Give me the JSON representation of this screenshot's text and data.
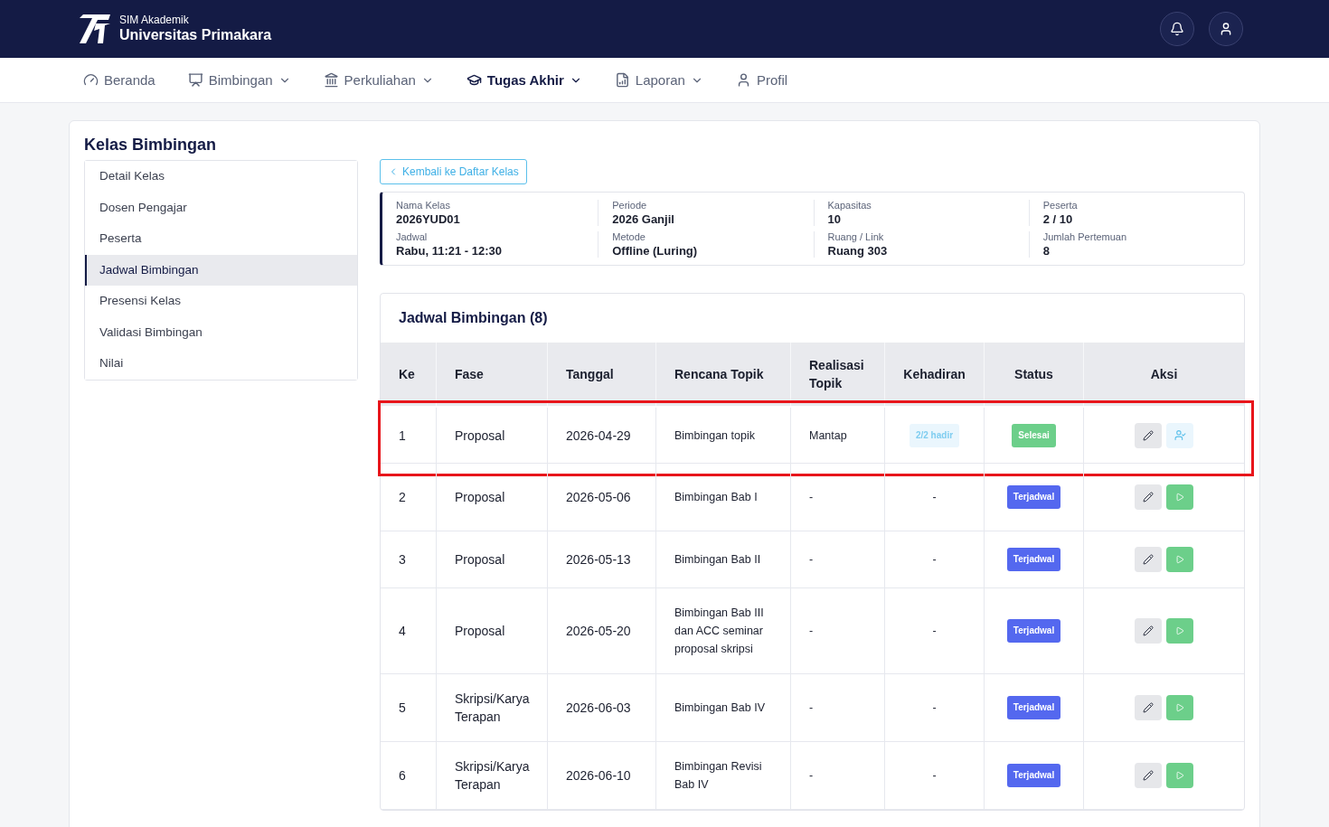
{
  "header": {
    "subtitle": "SIM Akademik",
    "title": "Universitas Primakara"
  },
  "nav": [
    {
      "label": "Beranda",
      "dropdown": false,
      "selected": false
    },
    {
      "label": "Bimbingan",
      "dropdown": true,
      "selected": false
    },
    {
      "label": "Perkuliahan",
      "dropdown": true,
      "selected": false
    },
    {
      "label": "Tugas Akhir",
      "dropdown": true,
      "selected": true
    },
    {
      "label": "Laporan",
      "dropdown": true,
      "selected": false
    },
    {
      "label": "Profil",
      "dropdown": false,
      "selected": false
    }
  ],
  "page_title": "Kelas Bimbingan",
  "sidebar": {
    "items": [
      {
        "label": "Detail Kelas",
        "selected": false
      },
      {
        "label": "Dosen Pengajar",
        "selected": false
      },
      {
        "label": "Peserta",
        "selected": false
      },
      {
        "label": "Jadwal Bimbingan",
        "selected": true
      },
      {
        "label": "Presensi Kelas",
        "selected": false
      },
      {
        "label": "Validasi Bimbingan",
        "selected": false
      },
      {
        "label": "Nilai",
        "selected": false
      }
    ]
  },
  "back_button": "Kembali ke Daftar Kelas",
  "info": [
    {
      "label": "Nama Kelas",
      "value": "2026YUD01"
    },
    {
      "label": "Periode",
      "value": "2026 Ganjil"
    },
    {
      "label": "Kapasitas",
      "value": "10"
    },
    {
      "label": "Peserta",
      "value": "2 / 10"
    },
    {
      "label": "Jadwal",
      "value": "Rabu, 11:21 - 12:30"
    },
    {
      "label": "Metode",
      "value": "Offline (Luring)"
    },
    {
      "label": "Ruang / Link",
      "value": "Ruang 303"
    },
    {
      "label": "Jumlah Pertemuan",
      "value": "8"
    }
  ],
  "table": {
    "title": "Jadwal Bimbingan (8)",
    "columns": [
      "Ke",
      "Fase",
      "Tanggal",
      "Rencana Topik",
      "Realisasi Topik",
      "Kehadiran",
      "Status",
      "Aksi"
    ],
    "rows": [
      {
        "ke": "1",
        "fase": "Proposal",
        "tanggal": "2026-04-29",
        "rencana": "Bimbingan topik",
        "realisasi": "Mantap",
        "kehadiran": {
          "kind": "badge",
          "text": "2/2 hadir"
        },
        "status": {
          "text": "Selesai",
          "color": "#6ccf8a"
        },
        "actions": [
          {
            "kind": "edit"
          },
          {
            "kind": "attendance"
          }
        ],
        "highlighted": true
      },
      {
        "ke": "2",
        "fase": "Proposal",
        "tanggal": "2026-05-06",
        "rencana": "Bimbingan Bab I",
        "realisasi": "-",
        "kehadiran": {
          "kind": "text",
          "text": "-"
        },
        "status": {
          "text": "Terjadwal",
          "color": "#5468ef"
        },
        "actions": [
          {
            "kind": "edit"
          },
          {
            "kind": "start"
          }
        ],
        "highlighted": false
      },
      {
        "ke": "3",
        "fase": "Proposal",
        "tanggal": "2026-05-13",
        "rencana": "Bimbingan Bab II",
        "realisasi": "-",
        "kehadiran": {
          "kind": "text",
          "text": "-"
        },
        "status": {
          "text": "Terjadwal",
          "color": "#5468ef"
        },
        "actions": [
          {
            "kind": "edit"
          },
          {
            "kind": "start"
          }
        ],
        "highlighted": false
      },
      {
        "ke": "4",
        "fase": "Proposal",
        "tanggal": "2026-05-20",
        "rencana": "Bimbingan Bab III dan ACC seminar proposal skripsi",
        "realisasi": "-",
        "kehadiran": {
          "kind": "text",
          "text": "-"
        },
        "status": {
          "text": "Terjadwal",
          "color": "#5468ef"
        },
        "actions": [
          {
            "kind": "edit"
          },
          {
            "kind": "start"
          }
        ],
        "highlighted": false
      },
      {
        "ke": "5",
        "fase": "Skripsi/Karya Terapan",
        "tanggal": "2026-06-03",
        "rencana": "Bimbingan Bab IV",
        "realisasi": "-",
        "kehadiran": {
          "kind": "text",
          "text": "-"
        },
        "status": {
          "text": "Terjadwal",
          "color": "#5468ef"
        },
        "actions": [
          {
            "kind": "edit"
          },
          {
            "kind": "start"
          }
        ],
        "highlighted": false
      },
      {
        "ke": "6",
        "fase": "Skripsi/Karya Terapan",
        "tanggal": "2026-06-10",
        "rencana": "Bimbingan Revisi Bab IV",
        "realisasi": "-",
        "kehadiran": {
          "kind": "text",
          "text": "-"
        },
        "status": {
          "text": "Terjadwal",
          "color": "#5468ef"
        },
        "actions": [
          {
            "kind": "edit"
          },
          {
            "kind": "start"
          }
        ],
        "highlighted": false
      }
    ]
  }
}
